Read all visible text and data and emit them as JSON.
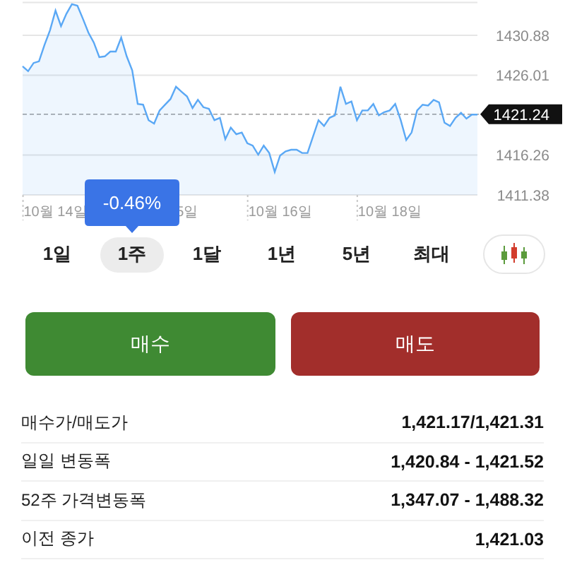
{
  "chart": {
    "chart_data": {
      "type": "area",
      "grid": true,
      "yticks": [
        1411.38,
        1416.26,
        {
          "value": 1421.24,
          "label": "1421.24"
        },
        1426.01,
        1430.88
      ],
      "ylim": [
        1411.38,
        1434.9
      ],
      "categories": [
        null,
        null,
        null,
        null,
        null,
        null,
        "10월 14일",
        null,
        null,
        null,
        null,
        null,
        null,
        null,
        null,
        null,
        null,
        null,
        null,
        null,
        null,
        null,
        null,
        null,
        null,
        null,
        null,
        null,
        null,
        null,
        "5일",
        null,
        null,
        null,
        null,
        null,
        null,
        null,
        null,
        null,
        null,
        null,
        null,
        null,
        null,
        null,
        null,
        "10월 16일",
        null,
        null,
        null,
        null,
        null,
        null,
        null,
        null,
        null,
        null,
        null,
        null,
        null,
        null,
        null,
        null,
        null,
        null,
        null,
        "10월 18일",
        null,
        null,
        null,
        null,
        null,
        null,
        null,
        null,
        null,
        null,
        null,
        null,
        null,
        null,
        null,
        null
      ],
      "series": [
        {
          "color": "#5aa8f5",
          "values": [
            1427.1,
            1426.5,
            1427.5,
            1427.7,
            1429.7,
            1431.5,
            1433.9,
            1432.0,
            1433.5,
            1434.7,
            1434.5,
            1432.9,
            1431.2,
            1430.0,
            1428.2,
            1428.3,
            1428.9,
            1428.9,
            1430.6,
            1428.3,
            1426.6,
            1422.5,
            1422.4,
            1420.5,
            1420.1,
            1421.7,
            1422.4,
            1423.1,
            1424.6,
            1424.0,
            1423.4,
            1422.0,
            1423.0,
            1422.1,
            1421.9,
            1420.5,
            1420.8,
            1418.2,
            1419.6,
            1418.8,
            1419.0,
            1417.7,
            1417.4,
            1416.3,
            1417.4,
            1416.5,
            1414.2,
            1416.2,
            1416.7,
            1416.9,
            1416.9,
            1416.5,
            1416.5,
            1418.5,
            1420.5,
            1419.8,
            1420.8,
            1421.1,
            1424.6,
            1422.5,
            1422.8,
            1420.5,
            1421.7,
            1421.7,
            1422.5,
            1421.1,
            1421.5,
            1421.7,
            1422.5,
            1420.5,
            1418.1,
            1419.0,
            1421.7,
            1422.4,
            1422.3,
            1423.0,
            1422.7,
            1420.2,
            1419.8,
            1420.8,
            1421.4,
            1420.7,
            1421.2,
            1421.2
          ]
        }
      ],
      "ref_lines": [
        {
          "axis": "y",
          "value": 1421.24
        }
      ]
    },
    "change_tooltip": "-0.46%"
  },
  "periods": [
    {
      "label": "1일",
      "selected": false
    },
    {
      "label": "1주",
      "selected": true
    },
    {
      "label": "1달",
      "selected": false
    },
    {
      "label": "1년",
      "selected": false
    },
    {
      "label": "5년",
      "selected": false
    },
    {
      "label": "최대",
      "selected": false
    }
  ],
  "actions": [
    {
      "kind": "buy",
      "label": "매수"
    },
    {
      "kind": "sell",
      "label": "매도"
    }
  ],
  "stats": [
    {
      "label": "매수가/매도가",
      "value": "1,421.17/1,421.31"
    },
    {
      "label": "일일 변동폭",
      "value": "1,420.84 - 1,421.52"
    },
    {
      "label": "52주 가격변동폭",
      "value": "1,347.07 - 1,488.32"
    },
    {
      "label": "이전 종가",
      "value": "1,421.03"
    }
  ]
}
